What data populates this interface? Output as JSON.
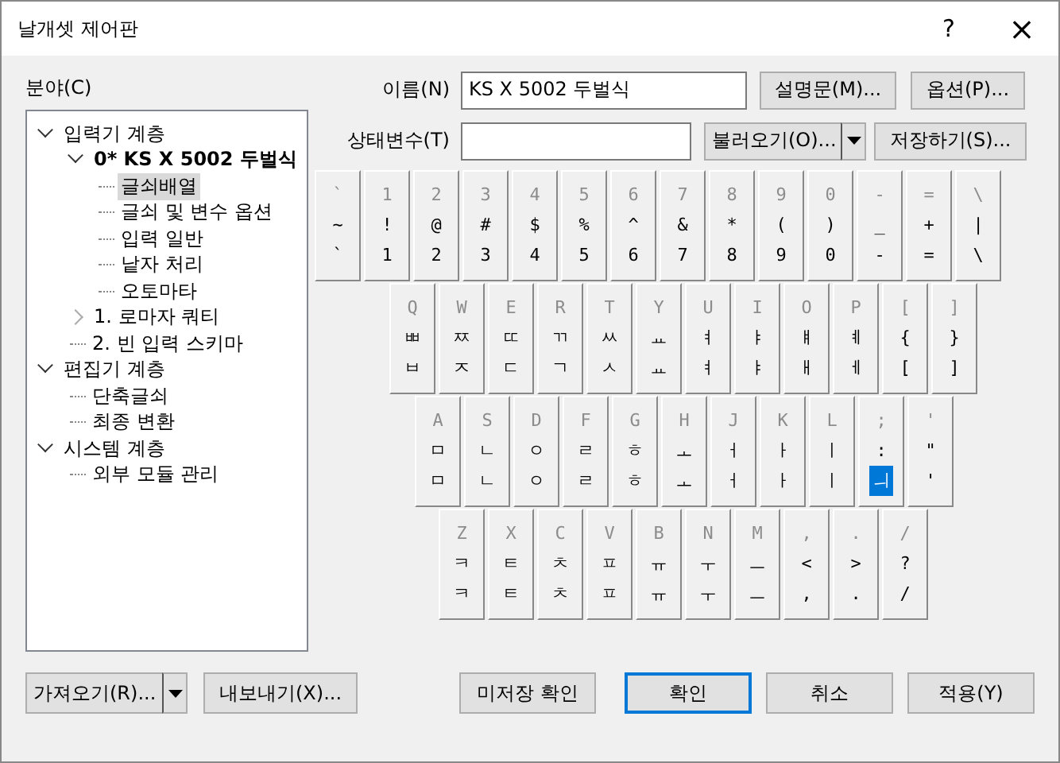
{
  "window": {
    "title": "날개셋 제어판",
    "help": "?",
    "close": "×"
  },
  "tree": {
    "label": "분야(C)",
    "items": [
      {
        "label": "입력기 계층",
        "expanded": true,
        "bold": false,
        "selected": false,
        "children": [
          {
            "label": "0* KS X 5002 두벌식",
            "expanded": true,
            "bold": true,
            "selected": false,
            "children": [
              {
                "label": "글쇠배열",
                "bold": false,
                "selected": true
              },
              {
                "label": "글쇠 및 변수 옵션",
                "bold": false,
                "selected": false
              },
              {
                "label": "입력 일반",
                "bold": false,
                "selected": false
              },
              {
                "label": "낱자 처리",
                "bold": false,
                "selected": false
              },
              {
                "label": "오토마타",
                "bold": false,
                "selected": false
              }
            ]
          },
          {
            "label": "1. 로마자 쿼티",
            "expanded": false,
            "bold": false,
            "selected": false
          },
          {
            "label": "2. 빈 입력 스키마",
            "bold": false,
            "selected": false
          }
        ]
      },
      {
        "label": "편집기 계층",
        "expanded": true,
        "bold": false,
        "selected": false,
        "children": [
          {
            "label": "단축글쇠",
            "bold": false,
            "selected": false
          },
          {
            "label": "최종 변환",
            "bold": false,
            "selected": false
          }
        ]
      },
      {
        "label": "시스템 계층",
        "expanded": true,
        "bold": false,
        "selected": false,
        "children": [
          {
            "label": "외부 모듈 관리",
            "bold": false,
            "selected": false
          }
        ]
      }
    ]
  },
  "name": {
    "label": "이름(N)",
    "value": "KS X 5002 두벌식"
  },
  "state_var": {
    "label": "상태변수(T)"
  },
  "buttons_top": {
    "description": "설명문(M)...",
    "options": "옵션(P)...",
    "load": "불러오기(O)...",
    "save": "저장하기(S)..."
  },
  "keyboard": [
    [
      {
        "label": "`",
        "upper": "~",
        "lower": "`",
        "selected": false
      },
      {
        "label": "1",
        "upper": "!",
        "lower": "1",
        "selected": false
      },
      {
        "label": "2",
        "upper": "@",
        "lower": "2",
        "selected": false
      },
      {
        "label": "3",
        "upper": "#",
        "lower": "3",
        "selected": false
      },
      {
        "label": "4",
        "upper": "$",
        "lower": "4",
        "selected": false
      },
      {
        "label": "5",
        "upper": "%",
        "lower": "5",
        "selected": false
      },
      {
        "label": "6",
        "upper": "^",
        "lower": "6",
        "selected": false
      },
      {
        "label": "7",
        "upper": "&",
        "lower": "7",
        "selected": false
      },
      {
        "label": "8",
        "upper": "*",
        "lower": "8",
        "selected": false
      },
      {
        "label": "9",
        "upper": "(",
        "lower": "9",
        "selected": false
      },
      {
        "label": "0",
        "upper": ")",
        "lower": "0",
        "selected": false
      },
      {
        "label": "-",
        "upper": "_",
        "lower": "-",
        "selected": false
      },
      {
        "label": "=",
        "upper": "+",
        "lower": "=",
        "selected": false
      },
      {
        "label": "\\",
        "upper": "|",
        "lower": "\\",
        "selected": false
      }
    ],
    [
      {
        "label": "Q",
        "upper": "ㅃ",
        "lower": "ㅂ",
        "selected": false
      },
      {
        "label": "W",
        "upper": "ㅉ",
        "lower": "ㅈ",
        "selected": false
      },
      {
        "label": "E",
        "upper": "ㄸ",
        "lower": "ㄷ",
        "selected": false
      },
      {
        "label": "R",
        "upper": "ㄲ",
        "lower": "ㄱ",
        "selected": false
      },
      {
        "label": "T",
        "upper": "ㅆ",
        "lower": "ㅅ",
        "selected": false
      },
      {
        "label": "Y",
        "upper": "ㅛ",
        "lower": "ㅛ",
        "selected": false
      },
      {
        "label": "U",
        "upper": "ㅕ",
        "lower": "ㅕ",
        "selected": false
      },
      {
        "label": "I",
        "upper": "ㅑ",
        "lower": "ㅑ",
        "selected": false
      },
      {
        "label": "O",
        "upper": "ㅒ",
        "lower": "ㅐ",
        "selected": false
      },
      {
        "label": "P",
        "upper": "ㅖ",
        "lower": "ㅔ",
        "selected": false
      },
      {
        "label": "[",
        "upper": "{",
        "lower": "[",
        "selected": false
      },
      {
        "label": "]",
        "upper": "}",
        "lower": "]",
        "selected": false
      }
    ],
    [
      {
        "label": "A",
        "upper": "ㅁ",
        "lower": "ㅁ",
        "selected": false
      },
      {
        "label": "S",
        "upper": "ㄴ",
        "lower": "ㄴ",
        "selected": false
      },
      {
        "label": "D",
        "upper": "ㅇ",
        "lower": "ㅇ",
        "selected": false
      },
      {
        "label": "F",
        "upper": "ㄹ",
        "lower": "ㄹ",
        "selected": false
      },
      {
        "label": "G",
        "upper": "ㅎ",
        "lower": "ㅎ",
        "selected": false
      },
      {
        "label": "H",
        "upper": "ㅗ",
        "lower": "ㅗ",
        "selected": false
      },
      {
        "label": "J",
        "upper": "ㅓ",
        "lower": "ㅓ",
        "selected": false
      },
      {
        "label": "K",
        "upper": "ㅏ",
        "lower": "ㅏ",
        "selected": false
      },
      {
        "label": "L",
        "upper": "ㅣ",
        "lower": "ㅣ",
        "selected": false
      },
      {
        "label": ";",
        "upper": ":",
        "lower": "ㅢ",
        "selected": true
      },
      {
        "label": "'",
        "upper": "\"",
        "lower": "'",
        "selected": false
      }
    ],
    [
      {
        "label": "Z",
        "upper": "ㅋ",
        "lower": "ㅋ",
        "selected": false
      },
      {
        "label": "X",
        "upper": "ㅌ",
        "lower": "ㅌ",
        "selected": false
      },
      {
        "label": "C",
        "upper": "ㅊ",
        "lower": "ㅊ",
        "selected": false
      },
      {
        "label": "V",
        "upper": "ㅍ",
        "lower": "ㅍ",
        "selected": false
      },
      {
        "label": "B",
        "upper": "ㅠ",
        "lower": "ㅠ",
        "selected": false
      },
      {
        "label": "N",
        "upper": "ㅜ",
        "lower": "ㅜ",
        "selected": false
      },
      {
        "label": "M",
        "upper": "ㅡ",
        "lower": "ㅡ",
        "selected": false
      },
      {
        "label": ",",
        "upper": "<",
        "lower": ",",
        "selected": false
      },
      {
        "label": ".",
        "upper": ">",
        "lower": ".",
        "selected": false
      },
      {
        "label": "/",
        "upper": "?",
        "lower": "/",
        "selected": false
      }
    ]
  ],
  "buttons_bottom": {
    "import": "가져오기(R)...",
    "export": "내보내기(X)...",
    "unsaved": "미저장 확인",
    "ok": "확인",
    "cancel": "취소",
    "apply": "적용(Y)"
  }
}
